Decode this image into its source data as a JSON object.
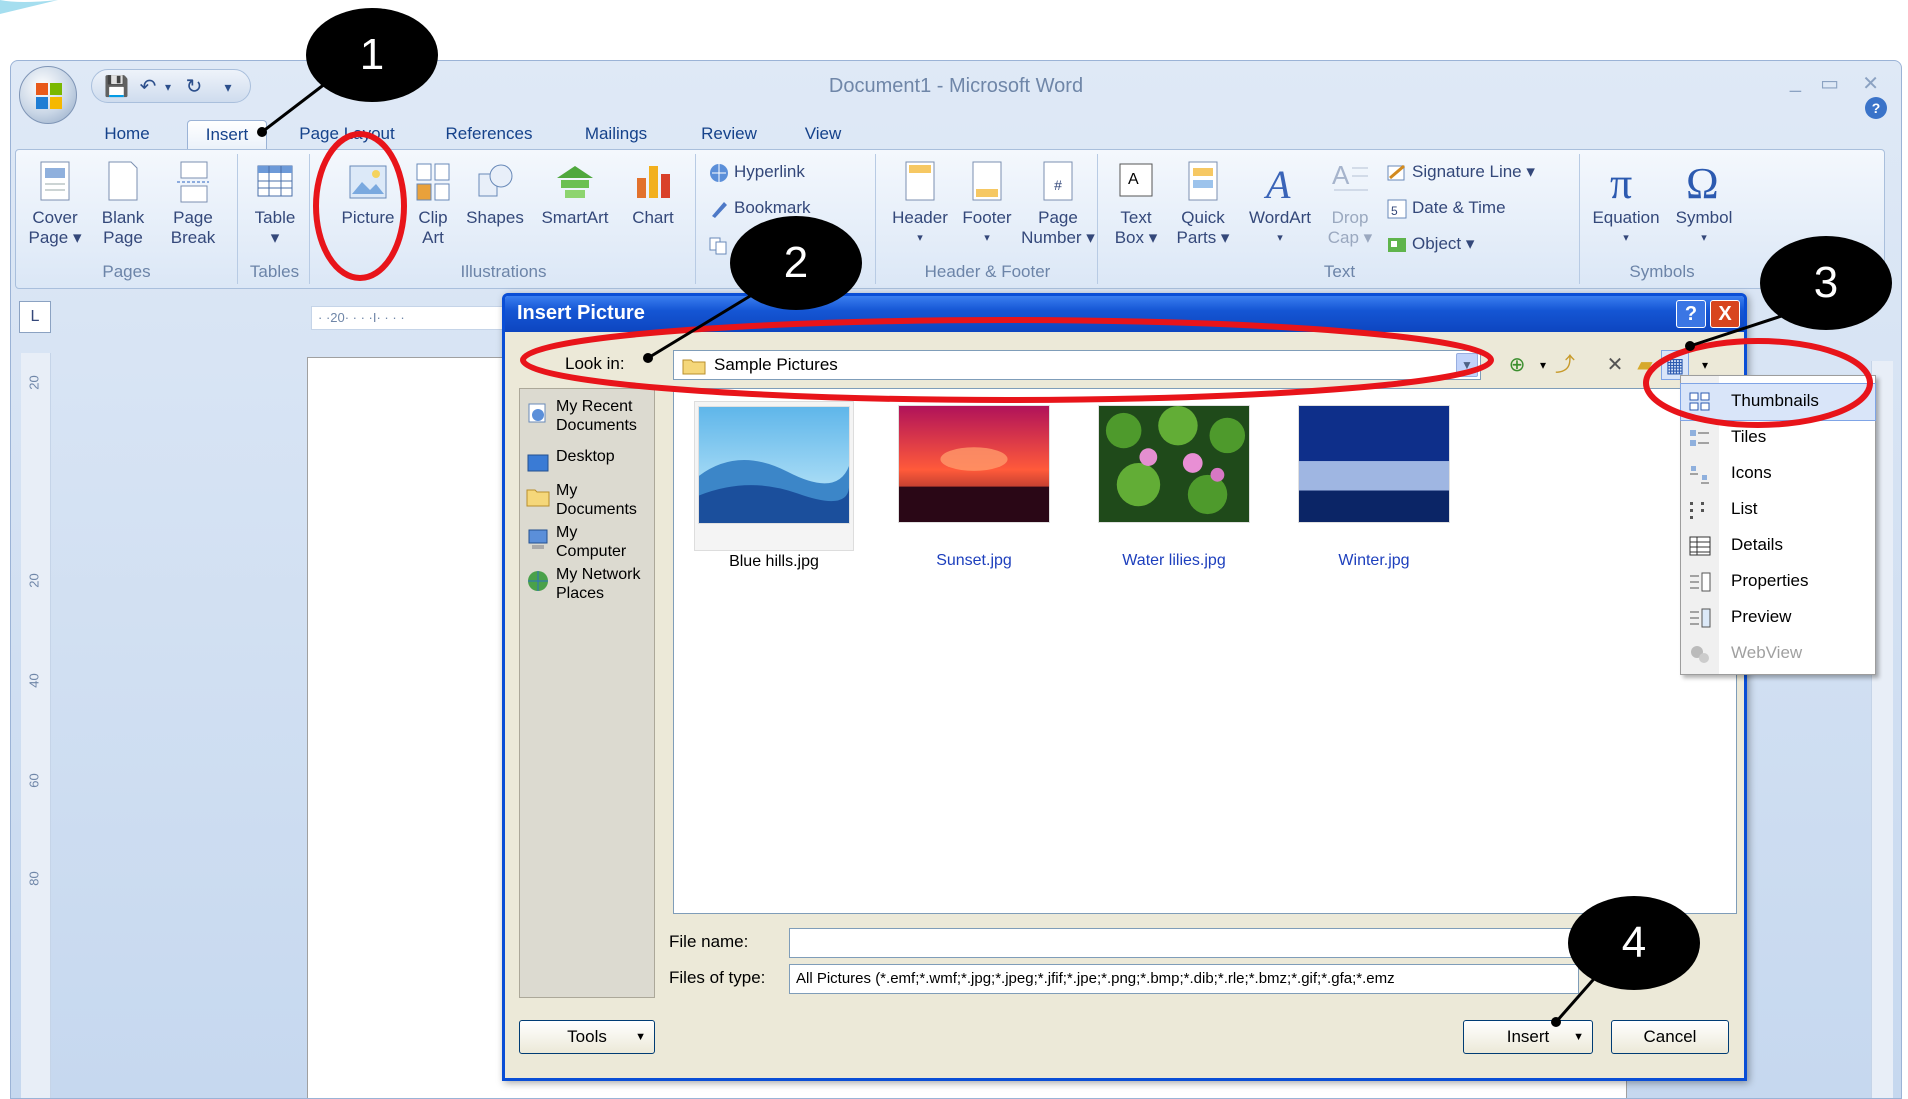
{
  "window": {
    "title": "Document1 - Microsoft Word",
    "controls": [
      "_",
      "▭",
      "✕"
    ]
  },
  "tabs": [
    "Home",
    "Insert",
    "Page Layout",
    "References",
    "Mailings",
    "Review",
    "View"
  ],
  "active_tab": "Insert",
  "ribbon": {
    "groups": {
      "pages": "Pages",
      "tables": "Tables",
      "illustrations": "Illustrations",
      "header_footer": "Header & Footer",
      "text": "Text",
      "symbols": "Symbols"
    },
    "buttons": {
      "cover_page": [
        "Cover",
        "Page ▾"
      ],
      "blank_page": [
        "Blank",
        "Page"
      ],
      "page_break": [
        "Page",
        "Break"
      ],
      "table": [
        "Table",
        "▾"
      ],
      "picture": "Picture",
      "clip_art": [
        "Clip",
        "Art"
      ],
      "shapes": "Shapes",
      "smartart": "SmartArt",
      "chart": "Chart",
      "hyperlink": "Hyperlink",
      "bookmark": "Bookmark",
      "header": "Header",
      "footer": "Footer",
      "page_number": [
        "Page",
        "Number ▾"
      ],
      "text_box": [
        "Text",
        "Box ▾"
      ],
      "quick_parts": [
        "Quick",
        "Parts ▾"
      ],
      "wordart": "WordArt",
      "drop_cap": [
        "Drop",
        "Cap ▾"
      ],
      "signature_line": "Signature Line ▾",
      "date_time": "Date & Time",
      "object": "Object ▾",
      "equation": "Equation",
      "symbol": "Symbol"
    }
  },
  "ruler": {
    "corner": "L",
    "h_marks": "· ·20· · · ·I· · · ·",
    "v_marks": [
      "20",
      "20",
      "40",
      "60",
      "80"
    ]
  },
  "dialog": {
    "title": "Insert Picture",
    "help": "?",
    "close": "X",
    "look_in_label": "Look in:",
    "look_in_value": "Sample Pictures",
    "places": [
      [
        "My Recent",
        "Documents"
      ],
      [
        "Desktop"
      ],
      [
        "My",
        "Documents"
      ],
      [
        "My",
        "Computer"
      ],
      [
        "My Network",
        "Places"
      ]
    ],
    "files": [
      "Blue hills.jpg",
      "Sunset.jpg",
      "Water lilies.jpg",
      "Winter.jpg"
    ],
    "file_name_label": "File name:",
    "file_name_value": "",
    "files_of_type_label": "Files of type:",
    "files_of_type_value": "All Pictures (*.emf;*.wmf;*.jpg;*.jpeg;*.jfif;*.jpe;*.png;*.bmp;*.dib;*.rle;*.bmz;*.gif;*.gfa;*.emz",
    "tools_label": "Tools",
    "insert_label": "Insert",
    "cancel_label": "Cancel"
  },
  "view_menu": [
    "Thumbnails",
    "Tiles",
    "Icons",
    "List",
    "Details",
    "Properties",
    "Preview",
    "WebView"
  ],
  "view_menu_selected": "Thumbnails",
  "view_menu_disabled": "WebView",
  "callouts": [
    "1",
    "2",
    "3",
    "4"
  ],
  "colors": {
    "accent_blue": "#15428b",
    "dialog_title": "#0a4ed6",
    "annotation_red": "#e8141a",
    "callout_black": "#000000"
  }
}
